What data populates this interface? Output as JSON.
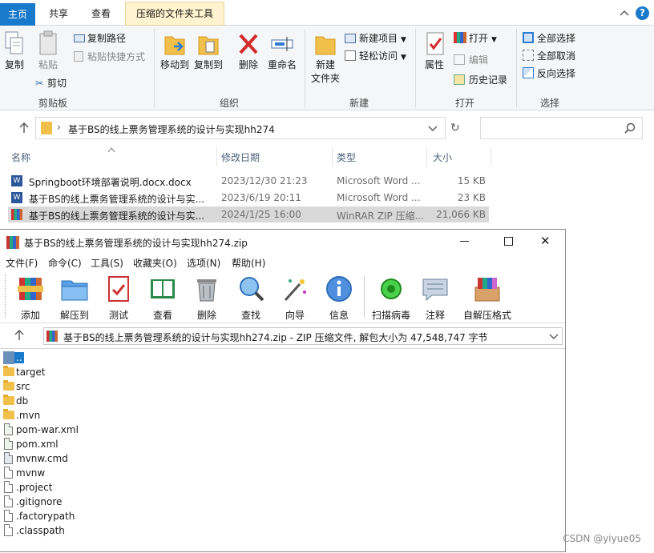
{
  "explorer": {
    "tabs": [
      "主页",
      "共享",
      "查看",
      "压缩的文件夹工具"
    ],
    "help_symbol": "?",
    "ribbon": {
      "clipboard": {
        "copy": "复制",
        "paste": "粘贴",
        "copy_path": "复制路径",
        "paste_shortcut": "粘贴快捷方式",
        "cut": "剪切",
        "group": "剪贴板"
      },
      "organize": {
        "move_to": "移动到",
        "copy_to": "复制到",
        "delete": "删除",
        "rename": "重命名",
        "group": "组织"
      },
      "new": {
        "new_folder_line1": "新建",
        "new_folder_line2": "文件夹",
        "new_item": "新建项目",
        "easy_access": "轻松访问",
        "group": "新建"
      },
      "open": {
        "properties": "属性",
        "open": "打开",
        "edit": "编辑",
        "history": "历史记录",
        "group": "打开"
      },
      "select": {
        "select_all": "全部选择",
        "select_none": "全部取消",
        "invert": "反向选择",
        "group": "选择"
      }
    },
    "address": {
      "path": "基于BS的线上票务管理系统的设计与实现hh274",
      "search_placeholder": ""
    },
    "columns": {
      "name": "名称",
      "modified": "修改日期",
      "type": "类型",
      "size": "大小"
    },
    "files": [
      {
        "name": "Springboot环境部署说明.docx.docx",
        "modified": "2023/12/30 21:23",
        "type": "Microsoft Word ...",
        "size": "15 KB",
        "icon": "word-icon"
      },
      {
        "name": "基于BS的线上票务管理系统的设计与实...",
        "modified": "2023/6/19 20:11",
        "type": "Microsoft Word ...",
        "size": "23 KB",
        "icon": "word-icon"
      },
      {
        "name": "基于BS的线上票务管理系统的设计与实...",
        "modified": "2024/1/25 16:00",
        "type": "WinRAR ZIP 压缩...",
        "size": "21,066 KB",
        "icon": "winrar-icon"
      }
    ]
  },
  "winrar": {
    "title": "基于BS的线上票务管理系统的设计与实现hh274.zip",
    "menu": [
      "文件(F)",
      "命令(C)",
      "工具(S)",
      "收藏夹(O)",
      "选项(N)",
      "帮助(H)"
    ],
    "toolbar": [
      "添加",
      "解压到",
      "测试",
      "查看",
      "删除",
      "查找",
      "向导",
      "信息",
      "扫描病毒",
      "注释",
      "自解压格式"
    ],
    "path": "基于BS的线上票务管理系统的设计与实现hh274.zip - ZIP 压缩文件, 解包大小为 47,548,747 字节",
    "items": [
      {
        "name": "..",
        "kind": "up"
      },
      {
        "name": "target",
        "kind": "folder"
      },
      {
        "name": "src",
        "kind": "folder"
      },
      {
        "name": "db",
        "kind": "folder"
      },
      {
        "name": ".mvn",
        "kind": "folder"
      },
      {
        "name": "pom-war.xml",
        "kind": "xml"
      },
      {
        "name": "pom.xml",
        "kind": "xml"
      },
      {
        "name": "mvnw.cmd",
        "kind": "cmd"
      },
      {
        "name": "mvnw",
        "kind": "file"
      },
      {
        "name": ".project",
        "kind": "file"
      },
      {
        "name": ".gitignore",
        "kind": "file"
      },
      {
        "name": ".factorypath",
        "kind": "file"
      },
      {
        "name": ".classpath",
        "kind": "file"
      }
    ]
  },
  "watermark": "CSDN @yiyue05",
  "colors": {
    "accent": "#1979ca",
    "selection": "#d9d9d9",
    "context_tab": "#fff4cf",
    "folder": "#f1c04b"
  }
}
